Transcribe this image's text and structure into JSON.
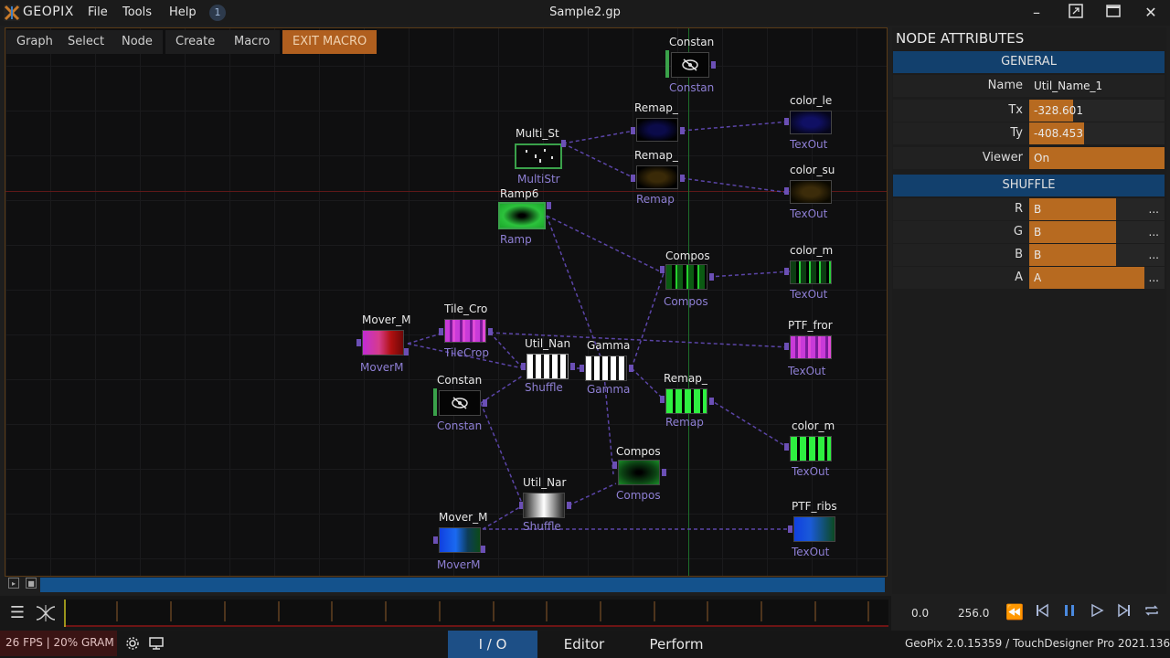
{
  "app": {
    "brand": "GEOPIX",
    "window_title": "Sample2.gp",
    "notification_count": "1"
  },
  "menu": {
    "file": "File",
    "tools": "Tools",
    "help": "Help"
  },
  "graph_toolbar": {
    "graph": "Graph",
    "select": "Select",
    "node": "Node",
    "create": "Create",
    "macro": "Macro",
    "exit_macro": "EXIT MACRO"
  },
  "nodes": {
    "constan_top": {
      "label": "Constan",
      "type": "Constan"
    },
    "remap1": {
      "label": "Remap_",
      "type": "Remap"
    },
    "color_le": {
      "label": "color_le",
      "type": "TexOut"
    },
    "multi_st": {
      "label": "Multi_St",
      "type": "MultiStr"
    },
    "remap2": {
      "label": "Remap_",
      "type": "Remap"
    },
    "color_su": {
      "label": "color_su",
      "type": "TexOut"
    },
    "ramp6": {
      "label": "Ramp6",
      "type": "Ramp"
    },
    "compos1": {
      "label": "Compos",
      "type": "Compos"
    },
    "color_m1": {
      "label": "color_m",
      "type": "TexOut"
    },
    "mover1": {
      "label": "Mover_M",
      "type": "MoverM"
    },
    "tile_cro": {
      "label": "Tile_Cro",
      "type": "TileCrop"
    },
    "util_nam1": {
      "label": "Util_Nan",
      "type": "Shuffle"
    },
    "gamma": {
      "label": "Gamma",
      "type": "Gamma"
    },
    "ptf_fro": {
      "label": "PTF_fror",
      "type": "TexOut"
    },
    "remap3": {
      "label": "Remap_",
      "type": "Remap"
    },
    "constan2": {
      "label": "Constan",
      "type": "Constan"
    },
    "color_m2": {
      "label": "color_m",
      "type": "TexOut"
    },
    "compos2": {
      "label": "Compos",
      "type": "Compos"
    },
    "util_nam2": {
      "label": "Util_Nar",
      "type": "Shuffle"
    },
    "mover2": {
      "label": "Mover_M",
      "type": "MoverM"
    },
    "ptf_ribs": {
      "label": "PTF_ribs",
      "type": "TexOut"
    }
  },
  "panel": {
    "title": "NODE ATTRIBUTES",
    "general": "GENERAL",
    "name_label": "Name",
    "name_value": "Util_Name_1",
    "tx_label": "Tx",
    "tx_value": "-328.601",
    "ty_label": "Ty",
    "ty_value": "-408.453",
    "viewer_label": "Viewer",
    "viewer_value": "On",
    "shuffle": "SHUFFLE",
    "r_label": "R",
    "r_value": "B",
    "g_label": "G",
    "g_value": "B",
    "b_label": "B",
    "b_value": "B",
    "a_label": "A",
    "a_value": "A",
    "dots": "..."
  },
  "transport": {
    "start": "0.0",
    "end": "256.0"
  },
  "status": {
    "fps": "26 FPS | 20% GRAM",
    "io": "I / O",
    "editor": "Editor",
    "perform": "Perform",
    "version": "GeoPix 2.0.15359 / TouchDesigner Pro 2021.13610"
  },
  "colors": {
    "accent": "#b76a20",
    "section": "#12406d",
    "node_type": "#8e7fd4",
    "active_tab": "#1d4f86"
  }
}
